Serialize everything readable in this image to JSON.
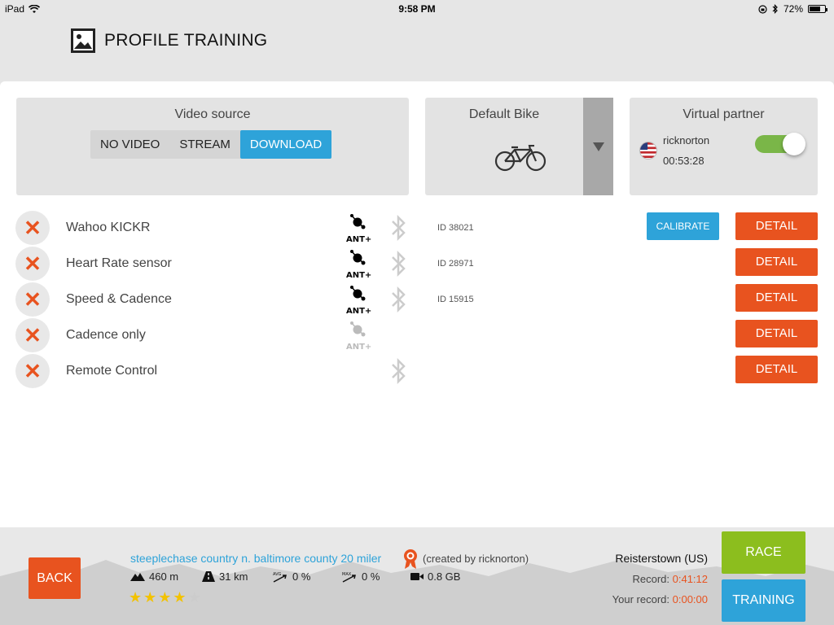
{
  "status": {
    "device": "iPad",
    "time": "9:58 PM",
    "battery": "72%",
    "battery_level": 0.72
  },
  "header": {
    "title": "PROFILE TRAINING",
    "icon": "picture-icon"
  },
  "video_source": {
    "title": "Video source",
    "options": [
      "NO VIDEO",
      "STREAM",
      "DOWNLOAD"
    ],
    "selected": "DOWNLOAD"
  },
  "bike": {
    "title": "Default Bike",
    "icon": "bicycle-icon"
  },
  "partner": {
    "title": "Virtual partner",
    "name": "ricknorton",
    "time": "00:53:28",
    "enabled": true
  },
  "sensors": [
    {
      "name": "Wahoo KICKR",
      "ant_active": true,
      "bluetooth": true,
      "id": "ID 38021",
      "calibrate": "CALIBRATE",
      "detail": "DETAIL"
    },
    {
      "name": "Heart Rate sensor",
      "ant_active": true,
      "bluetooth": true,
      "id": "ID 28971",
      "detail": "DETAIL"
    },
    {
      "name": "Speed & Cadence",
      "ant_active": true,
      "bluetooth": true,
      "id": "ID 15915",
      "detail": "DETAIL"
    },
    {
      "name": "Cadence only",
      "ant_active": false,
      "bluetooth": false,
      "id": "",
      "detail": "DETAIL"
    },
    {
      "name": "Remote Control",
      "ant_active": null,
      "bluetooth": true,
      "id": "",
      "detail": "DETAIL"
    }
  ],
  "ant_label": "ANT+",
  "bottom": {
    "back": "BACK",
    "route_name": "steeplechase country n. baltimore county 20 miler",
    "created_by": "(created by ricknorton)",
    "elevation": "460 m",
    "distance": "31 km",
    "avg_grade": "0 %",
    "max_grade": "0 %",
    "size": "0.8 GB",
    "rating": 4,
    "rating_max": 5,
    "location": "Reisterstown (US)",
    "record_label": "Record:",
    "record_value": "0:41:12",
    "your_record_label": "Your record:",
    "your_record_value": "0:00:00",
    "race": "RACE",
    "training": "TRAINING"
  },
  "colors": {
    "accent_orange": "#e8531f",
    "accent_blue": "#2ea3d9",
    "accent_green": "#8cbe1e"
  }
}
